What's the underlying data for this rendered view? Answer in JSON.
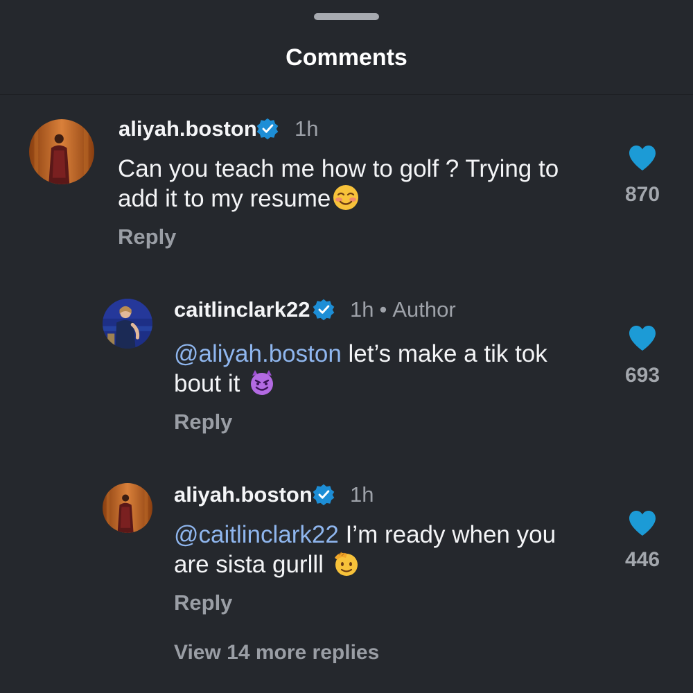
{
  "header": {
    "title": "Comments"
  },
  "comments": [
    {
      "username": "aliyah.boston",
      "time": "1h",
      "author_tag": "",
      "mention": "",
      "text_line1": "Can you teach me how to golf ? Trying to",
      "text_line2": "add it to my resume",
      "emoji_icon": "smiling-blushing-face-icon",
      "likes": "870",
      "reply_label": "Reply"
    },
    {
      "username": "caitlinclark22",
      "time": "1h",
      "author_tag": "Author",
      "mention": "@aliyah.boston",
      "text_line1": " let’s make a tik tok",
      "text_line2": "bout it ",
      "emoji_icon": "smiling-devil-face-icon",
      "likes": "693",
      "reply_label": "Reply"
    },
    {
      "username": "aliyah.boston",
      "time": "1h",
      "author_tag": "",
      "mention": "@caitlinclark22",
      "text_line1": " I’m ready when you",
      "text_line2": "are sista gurlll ",
      "emoji_icon": "saluting-face-icon",
      "likes": "446",
      "reply_label": "Reply"
    }
  ],
  "view_more": "View 14 more replies",
  "colors": {
    "background": "#25282d",
    "like_heart": "#1c9bd6",
    "verified_badge": "#1d8ed6",
    "mention": "#8fb6ee"
  }
}
